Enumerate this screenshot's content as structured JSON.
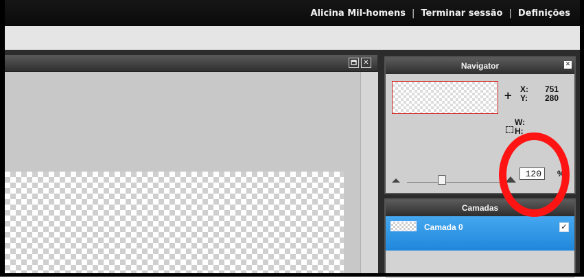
{
  "header": {
    "user_name": "Alicina Mil-homens",
    "separator": "|",
    "logout_label": "Terminar sessão",
    "settings_label": "Definições"
  },
  "canvas_window": {
    "maximize_icon": "maximize-icon",
    "close_glyph": "✕"
  },
  "navigator": {
    "title": "Navigator",
    "close_glyph": "✕",
    "x_label": "X:",
    "x_value": "751",
    "y_label": "Y:",
    "y_value": "280",
    "w_label": "W:",
    "h_label": "H:",
    "zoom_value": "120",
    "zoom_unit": "%",
    "zoom_slider_level": 0.36
  },
  "layers": {
    "title": "Camadas",
    "items": [
      {
        "name": "Camada 0",
        "visible": true,
        "check_glyph": "✓"
      }
    ]
  },
  "colors": {
    "topbar": "#0a0a0a",
    "selection_blue": "#1f87db",
    "annotation_red": "#ff1414",
    "thumbnail_border": "#d21f1f"
  }
}
